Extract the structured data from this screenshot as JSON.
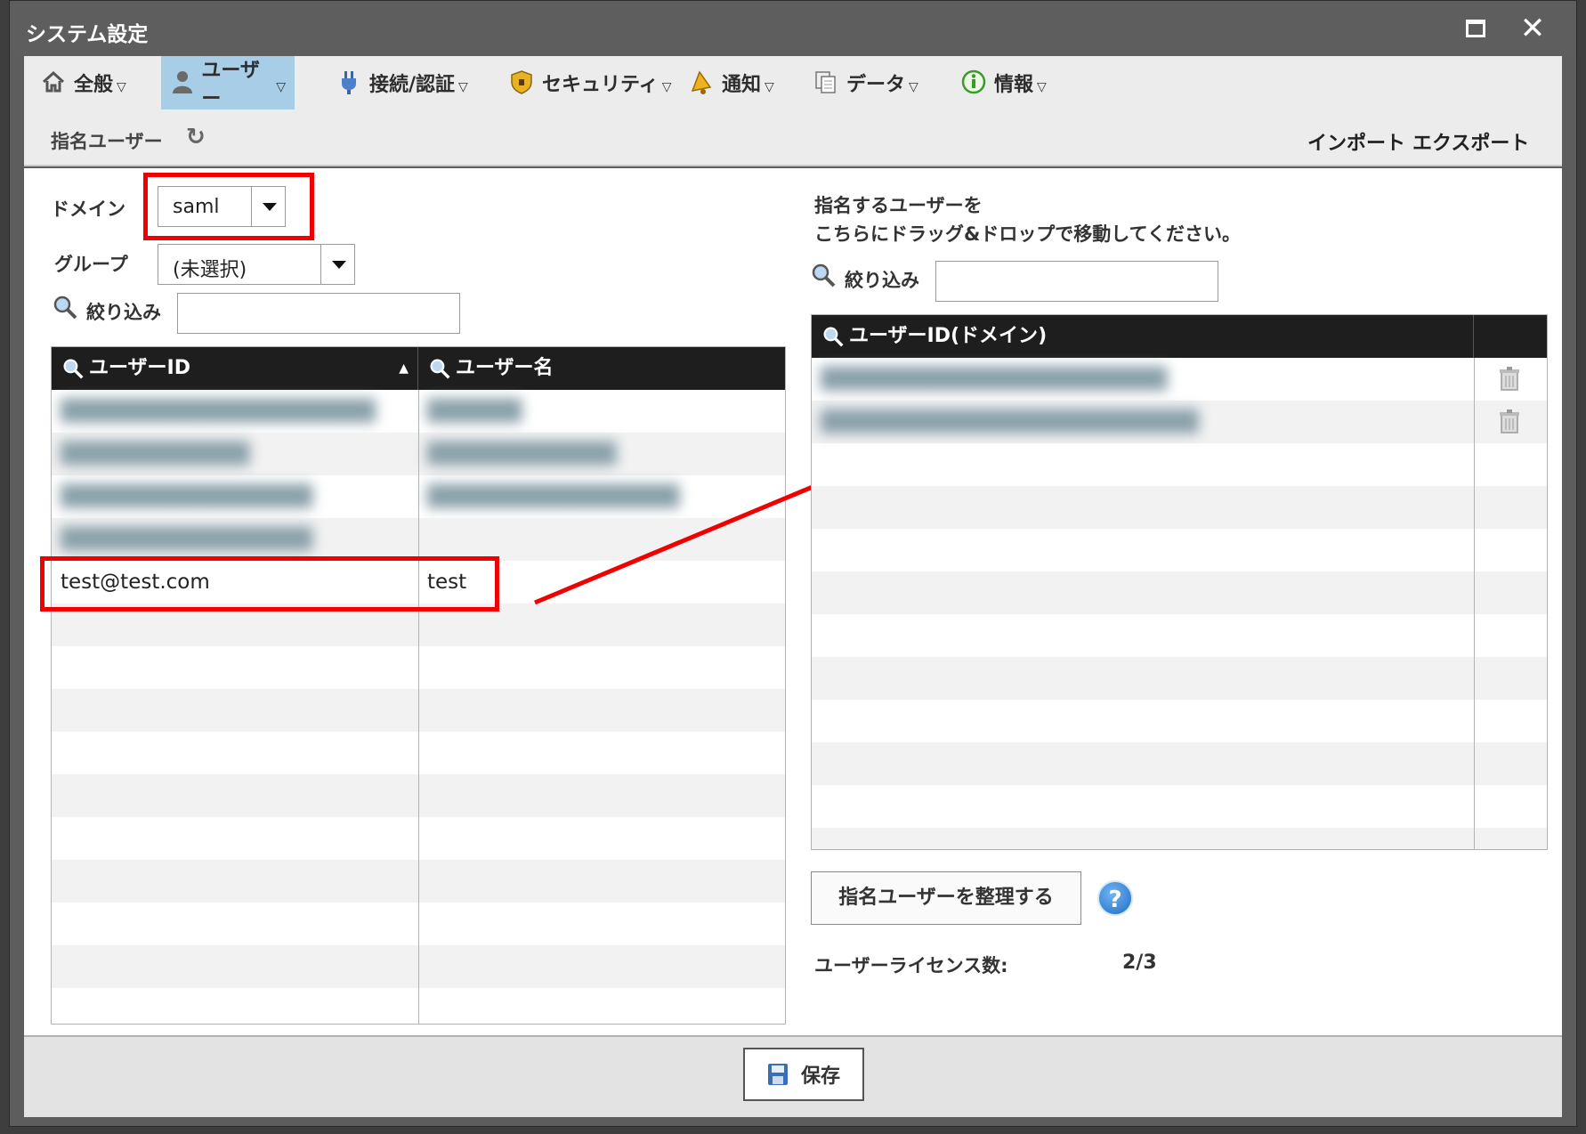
{
  "window": {
    "title": "システム設定"
  },
  "menu": [
    {
      "label": "全般",
      "icon": "home-icon"
    },
    {
      "label": "ユーザー",
      "icon": "user-icon",
      "active": true
    },
    {
      "label": "接続/認証",
      "icon": "plug-icon"
    },
    {
      "label": "セキュリティ",
      "icon": "shield-icon"
    },
    {
      "label": "通知",
      "icon": "bell-icon"
    },
    {
      "label": "データ",
      "icon": "documents-icon"
    },
    {
      "label": "情報",
      "icon": "info-icon"
    }
  ],
  "subheader": {
    "title": "指名ユーザー",
    "import": "インポート",
    "export": "エクスポート"
  },
  "left": {
    "domain_label": "ドメイン",
    "domain_value": "saml",
    "group_label": "グループ",
    "group_value": "(未選択)",
    "filter_label": "絞り込み",
    "columns": [
      "ユーザーID",
      "ユーザー名"
    ],
    "rows": [
      {
        "id": "",
        "name": "",
        "blurred": true
      },
      {
        "id": "",
        "name": "",
        "blurred": true
      },
      {
        "id": "",
        "name": "",
        "blurred": true
      },
      {
        "id": "",
        "name": "",
        "blurred": true
      },
      {
        "id": "test@test.com",
        "name": "test",
        "blurred": false
      }
    ]
  },
  "right": {
    "instruction_line1": "指名するユーザーを",
    "instruction_line2": "こちらにドラッグ&ドロップで移動してください。",
    "filter_label": "絞り込み",
    "column": "ユーザーID(ドメイン)",
    "rows": [
      {
        "id": "",
        "blurred": true
      },
      {
        "id": "",
        "blurred": true
      }
    ],
    "organize_button": "指名ユーザーを整理する",
    "license_label": "ユーザーライセンス数:",
    "license_value": "2/3"
  },
  "footer": {
    "save_label": "保存"
  },
  "colors": {
    "highlight": "#f00000",
    "active_tab": "#a8cde6",
    "grid_header": "#1e1e1e"
  }
}
